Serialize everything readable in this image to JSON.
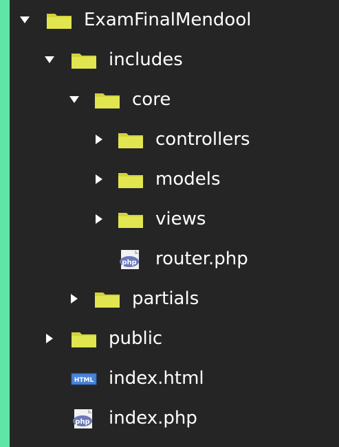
{
  "tree": [
    {
      "label": "ExamFinalMendool",
      "type": "folder",
      "expanded": true,
      "level": 0
    },
    {
      "label": "includes",
      "type": "folder",
      "expanded": true,
      "level": 1
    },
    {
      "label": "core",
      "type": "folder",
      "expanded": true,
      "level": 2
    },
    {
      "label": "controllers",
      "type": "folder",
      "expanded": false,
      "level": 3
    },
    {
      "label": "models",
      "type": "folder",
      "expanded": false,
      "level": 3
    },
    {
      "label": "views",
      "type": "folder",
      "expanded": false,
      "level": 3
    },
    {
      "label": "router.php",
      "type": "php-file",
      "level": 3
    },
    {
      "label": "partials",
      "type": "folder",
      "expanded": false,
      "level": 2
    },
    {
      "label": "public",
      "type": "folder",
      "expanded": false,
      "level": 1
    },
    {
      "label": "index.html",
      "type": "html-file",
      "level": 1
    },
    {
      "label": "index.php",
      "type": "php-file",
      "level": 1
    }
  ],
  "icons": {
    "folder": "folder-icon",
    "php-file": "php-file-icon",
    "html-file": "html-file-icon",
    "expanded": "triangle-down-icon",
    "collapsed": "triangle-right-icon"
  },
  "colors": {
    "background": "#252526",
    "frame": "#5fe6a7",
    "text": "#ffffff",
    "folder": "#c8c832",
    "arrow": "#ffffff"
  }
}
